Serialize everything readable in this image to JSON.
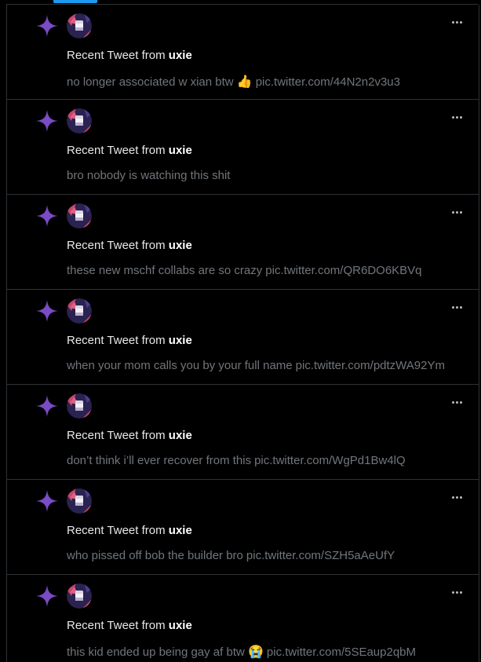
{
  "feed": {
    "items": [
      {
        "prefix": "Recent Tweet from",
        "user": "uxie",
        "text": "no longer associated w xian btw",
        "emoji": "👍",
        "link": "pic.twitter.com/44N2n2v3u3"
      },
      {
        "prefix": "Recent Tweet from",
        "user": "uxie",
        "text": "bro nobody is watching this shit",
        "emoji": "",
        "link": ""
      },
      {
        "prefix": "Recent Tweet from",
        "user": "uxie",
        "text": "these new mschf collabs are so crazy",
        "emoji": "",
        "link": "pic.twitter.com/QR6DO6KBVq"
      },
      {
        "prefix": "Recent Tweet from",
        "user": "uxie",
        "text": "when your mom calls you by your full name",
        "emoji": "",
        "link": "pic.twitter.com/pdtzWA92Ym"
      },
      {
        "prefix": "Recent Tweet from",
        "user": "uxie",
        "text": "don’t think i’ll ever recover from this",
        "emoji": "",
        "link": "pic.twitter.com/WgPd1Bw4lQ"
      },
      {
        "prefix": "Recent Tweet from",
        "user": "uxie",
        "text": "who pissed off bob the builder bro",
        "emoji": "",
        "link": "pic.twitter.com/SZH5aAeUfY"
      },
      {
        "prefix": "Recent Tweet from",
        "user": "uxie",
        "text": "this kid ended up being gay af btw",
        "emoji": "😭",
        "link": "pic.twitter.com/5SEaup2qbM"
      }
    ],
    "icons": {
      "notification": "sparkle-icon",
      "menu": "more-icon"
    }
  },
  "colors": {
    "background": "#000000",
    "border": "#2f3336",
    "accent_tab": "#1d9bf0",
    "sparkle": "#794bc4",
    "text_primary": "#e7e9ea",
    "text_secondary": "#71767b"
  }
}
